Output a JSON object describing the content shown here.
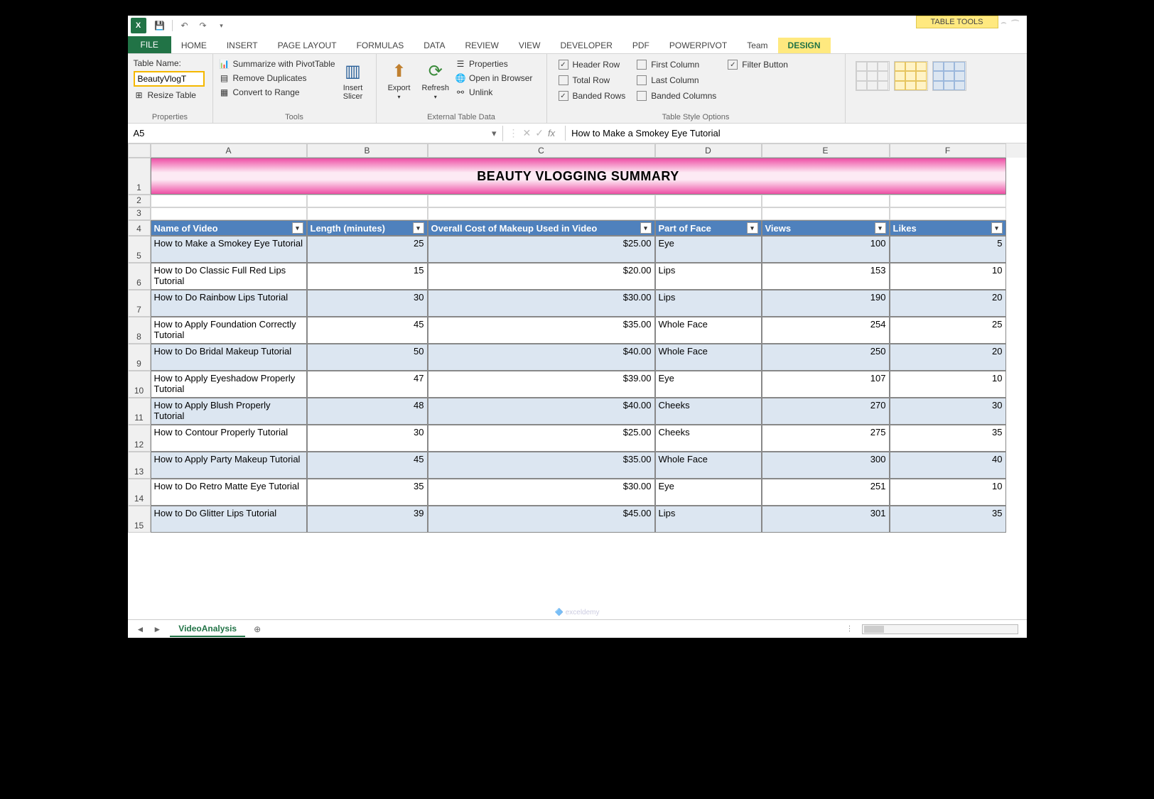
{
  "titlebar": {
    "table_tools": "TABLE TOOLS"
  },
  "tabs": {
    "file": "FILE",
    "home": "HOME",
    "insert": "INSERT",
    "pagelayout": "PAGE LAYOUT",
    "formulas": "FORMULAS",
    "data": "DATA",
    "review": "REVIEW",
    "view": "VIEW",
    "developer": "DEVELOPER",
    "pdf": "PDF",
    "powerpivot": "POWERPIVOT",
    "team": "Team",
    "design": "DESIGN"
  },
  "ribbon": {
    "properties": {
      "label": "Properties",
      "table_name_label": "Table Name:",
      "table_name_value": "BeautyVlogT",
      "resize": "Resize Table"
    },
    "tools": {
      "label": "Tools",
      "pivot": "Summarize with PivotTable",
      "dup": "Remove Duplicates",
      "range": "Convert to Range",
      "slicer": "Insert\nSlicer"
    },
    "external": {
      "label": "External Table Data",
      "export": "Export",
      "refresh": "Refresh",
      "props": "Properties",
      "browser": "Open in Browser",
      "unlink": "Unlink"
    },
    "styleopts": {
      "label": "Table Style Options",
      "header": "Header Row",
      "total": "Total Row",
      "banded_r": "Banded Rows",
      "first": "First Column",
      "last": "Last Column",
      "banded_c": "Banded Columns",
      "filter": "Filter Button"
    }
  },
  "formula_bar": {
    "name_box": "A5",
    "value": "How to Make a Smokey Eye Tutorial"
  },
  "columns": {
    "widths": [
      220,
      170,
      320,
      150,
      180,
      164
    ],
    "letters": [
      "A",
      "B",
      "C",
      "D",
      "E",
      "F"
    ]
  },
  "title_row": "BEAUTY VLOGGING SUMMARY",
  "headers": [
    "Name of Video",
    "Length (minutes)",
    "Overall Cost of Makeup Used in Video",
    "Part of Face",
    "Views",
    "Likes"
  ],
  "rows": [
    {
      "n": 5,
      "name": "How to Make a Smokey Eye Tutorial",
      "len": "25",
      "cost": "$25.00",
      "part": "Eye",
      "views": "100",
      "likes": "5"
    },
    {
      "n": 6,
      "name": "How to Do Classic Full Red Lips Tutorial",
      "len": "15",
      "cost": "$20.00",
      "part": "Lips",
      "views": "153",
      "likes": "10"
    },
    {
      "n": 7,
      "name": "How to Do Rainbow Lips Tutorial",
      "len": "30",
      "cost": "$30.00",
      "part": "Lips",
      "views": "190",
      "likes": "20"
    },
    {
      "n": 8,
      "name": "How to Apply Foundation Correctly Tutorial",
      "len": "45",
      "cost": "$35.00",
      "part": "Whole Face",
      "views": "254",
      "likes": "25"
    },
    {
      "n": 9,
      "name": "How to Do Bridal Makeup Tutorial",
      "len": "50",
      "cost": "$40.00",
      "part": "Whole Face",
      "views": "250",
      "likes": "20"
    },
    {
      "n": 10,
      "name": "How to Apply Eyeshadow Properly Tutorial",
      "len": "47",
      "cost": "$39.00",
      "part": "Eye",
      "views": "107",
      "likes": "10"
    },
    {
      "n": 11,
      "name": "How to Apply Blush Properly Tutorial",
      "len": "48",
      "cost": "$40.00",
      "part": "Cheeks",
      "views": "270",
      "likes": "30"
    },
    {
      "n": 12,
      "name": "How to Contour Properly Tutorial",
      "len": "30",
      "cost": "$25.00",
      "part": "Cheeks",
      "views": "275",
      "likes": "35"
    },
    {
      "n": 13,
      "name": "How to Apply Party Makeup Tutorial",
      "len": "45",
      "cost": "$35.00",
      "part": "Whole Face",
      "views": "300",
      "likes": "40"
    },
    {
      "n": 14,
      "name": "How to Do Retro Matte Eye Tutorial",
      "len": "35",
      "cost": "$30.00",
      "part": "Eye",
      "views": "251",
      "likes": "10"
    },
    {
      "n": 15,
      "name": "How to Do Glitter Lips Tutorial",
      "len": "39",
      "cost": "$45.00",
      "part": "Lips",
      "views": "301",
      "likes": "35"
    }
  ],
  "sheet_tabs": {
    "active": "VideoAnalysis"
  },
  "chart_data": {
    "type": "table",
    "title": "BEAUTY VLOGGING SUMMARY",
    "columns": [
      "Name of Video",
      "Length (minutes)",
      "Overall Cost of Makeup Used in Video",
      "Part of Face",
      "Views",
      "Likes"
    ],
    "rows": [
      [
        "How to Make a Smokey Eye Tutorial",
        25,
        25.0,
        "Eye",
        100,
        5
      ],
      [
        "How to Do Classic Full Red Lips Tutorial",
        15,
        20.0,
        "Lips",
        153,
        10
      ],
      [
        "How to Do Rainbow Lips Tutorial",
        30,
        30.0,
        "Lips",
        190,
        20
      ],
      [
        "How to Apply Foundation Correctly Tutorial",
        45,
        35.0,
        "Whole Face",
        254,
        25
      ],
      [
        "How to Do Bridal Makeup Tutorial",
        50,
        40.0,
        "Whole Face",
        250,
        20
      ],
      [
        "How to Apply Eyeshadow Properly Tutorial",
        47,
        39.0,
        "Eye",
        107,
        10
      ],
      [
        "How to Apply Blush Properly Tutorial",
        48,
        40.0,
        "Cheeks",
        270,
        30
      ],
      [
        "How to Contour Properly Tutorial",
        30,
        25.0,
        "Cheeks",
        275,
        35
      ],
      [
        "How to Apply Party Makeup Tutorial",
        45,
        35.0,
        "Whole Face",
        300,
        40
      ],
      [
        "How to Do Retro Matte Eye Tutorial",
        35,
        30.0,
        "Eye",
        251,
        10
      ],
      [
        "How to Do Glitter Lips Tutorial",
        39,
        45.0,
        "Lips",
        301,
        35
      ]
    ]
  }
}
